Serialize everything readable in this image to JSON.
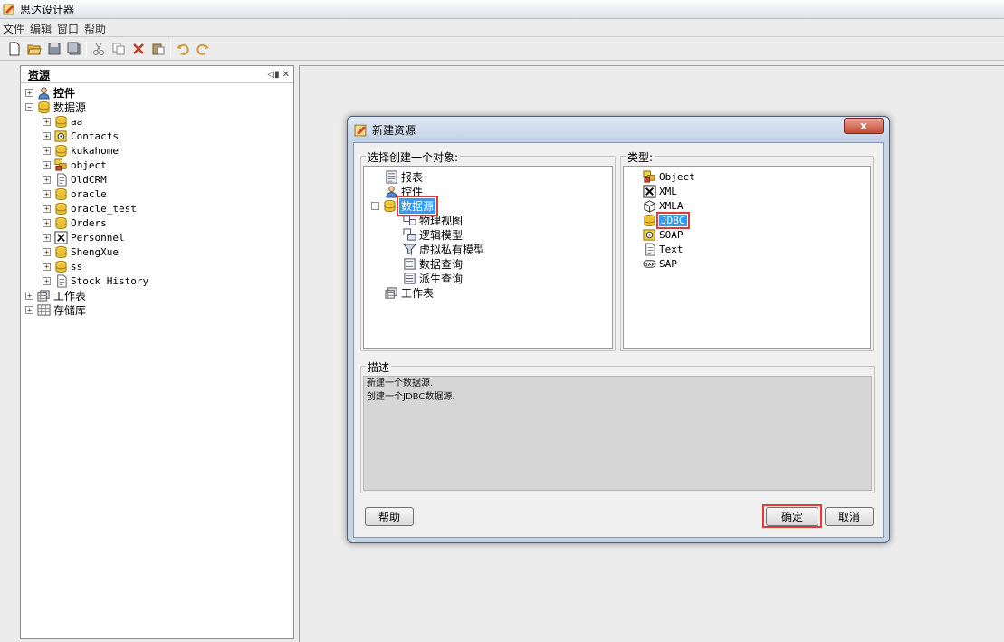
{
  "window": {
    "title": "思达设计器",
    "icon": "designer-app-icon"
  },
  "menu": [
    "文件",
    "编辑",
    "窗口",
    "帮助"
  ],
  "toolbar": {
    "buttons": [
      "new-file-icon",
      "open-folder-icon",
      "save-icon",
      "save-all-icon",
      "cut-icon",
      "copy-icon",
      "delete-icon",
      "paste-icon",
      "undo-icon",
      "redo-icon"
    ]
  },
  "resource_panel": {
    "title": "资源",
    "tools": [
      "pin-icon",
      "close-icon"
    ],
    "tree": [
      {
        "label": "控件",
        "icon": "controls-icon",
        "level": 0,
        "bold": true
      },
      {
        "label": "数据源",
        "icon": "database-icon",
        "level": 0,
        "expanded": true
      },
      {
        "label": "aa",
        "icon": "database-icon",
        "level": 1
      },
      {
        "label": "Contacts",
        "icon": "soap-icon",
        "level": 1
      },
      {
        "label": "kukahome",
        "icon": "database-icon",
        "level": 1
      },
      {
        "label": "object",
        "icon": "object-icon",
        "level": 1
      },
      {
        "label": "OldCRM",
        "icon": "text-file-icon",
        "level": 1
      },
      {
        "label": "oracle",
        "icon": "database-icon",
        "level": 1
      },
      {
        "label": "oracle_test",
        "icon": "database-icon",
        "level": 1
      },
      {
        "label": "Orders",
        "icon": "database-icon",
        "level": 1
      },
      {
        "label": "Personnel",
        "icon": "excel-icon",
        "level": 1
      },
      {
        "label": "ShengXue",
        "icon": "database-icon",
        "level": 1
      },
      {
        "label": "ss",
        "icon": "database-icon",
        "level": 1
      },
      {
        "label": "Stock History",
        "icon": "text-file-icon",
        "level": 1
      },
      {
        "label": "工作表",
        "icon": "worksheet-icon",
        "level": 0
      },
      {
        "label": "存储库",
        "icon": "repository-icon",
        "level": 0
      }
    ]
  },
  "dialog": {
    "title": "新建资源",
    "close_label": "x",
    "object_group_label": "选择创建一个对象:",
    "type_group_label": "类型:",
    "object_tree": [
      {
        "label": "报表",
        "icon": "report-icon",
        "level": 0
      },
      {
        "label": "控件",
        "icon": "controls-icon",
        "level": 0
      },
      {
        "label": "数据源",
        "icon": "database-icon",
        "level": 0,
        "selected": true
      },
      {
        "label": "物理视图",
        "icon": "physical-view-icon",
        "level": 1
      },
      {
        "label": "逻辑模型",
        "icon": "logical-model-icon",
        "level": 1
      },
      {
        "label": "虚拟私有模型",
        "icon": "filter-icon",
        "level": 1
      },
      {
        "label": "数据查询",
        "icon": "query-icon",
        "level": 1
      },
      {
        "label": "派生查询",
        "icon": "query-icon",
        "level": 1
      },
      {
        "label": "工作表",
        "icon": "worksheet-icon",
        "level": 0
      }
    ],
    "types": [
      {
        "label": "Object",
        "icon": "object-icon"
      },
      {
        "label": "XML",
        "icon": "xml-icon"
      },
      {
        "label": "XMLA",
        "icon": "cube-icon"
      },
      {
        "label": "JDBC",
        "icon": "database-icon",
        "selected": true
      },
      {
        "label": "SOAP",
        "icon": "soap-icon"
      },
      {
        "label": "Text",
        "icon": "text-file-icon"
      },
      {
        "label": "SAP",
        "icon": "sap-icon"
      }
    ],
    "description_label": "描述",
    "description_lines": [
      "新建一个数据源.",
      "创建一个JDBC数据源."
    ],
    "help_button": "帮助",
    "ok_button": "确定",
    "cancel_button": "取消"
  },
  "colors": {
    "selection": "#3399ff",
    "highlight_frame": "#e03a3a",
    "dialog_frame": "#c7d5e7"
  }
}
